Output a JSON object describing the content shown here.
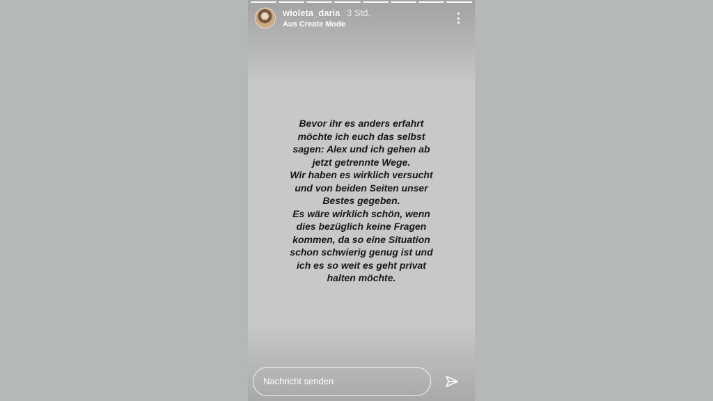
{
  "story": {
    "username": "wioleta_daria",
    "timestamp": "3 Std.",
    "subtitle": "Aus Create Mode",
    "segments": 8,
    "text_lines": [
      "Bevor ihr es anders erfahrt",
      "möchte ich euch das selbst",
      "sagen: Alex und ich gehen ab",
      "jetzt getrennte Wege.",
      "Wir haben es wirklich versucht",
      "und von beiden Seiten unser",
      "Bestes gegeben.",
      "Es wäre wirklich schön, wenn",
      "dies bezüglich keine Fragen",
      "kommen, da so eine Situation",
      "schon schwierig genug ist und",
      "ich es so weit es geht privat",
      "halten möchte."
    ]
  },
  "reply": {
    "placeholder": "Nachricht senden"
  },
  "icons": {
    "more": "more-vertical-icon",
    "send": "send-icon",
    "avatar": "profile-avatar"
  }
}
